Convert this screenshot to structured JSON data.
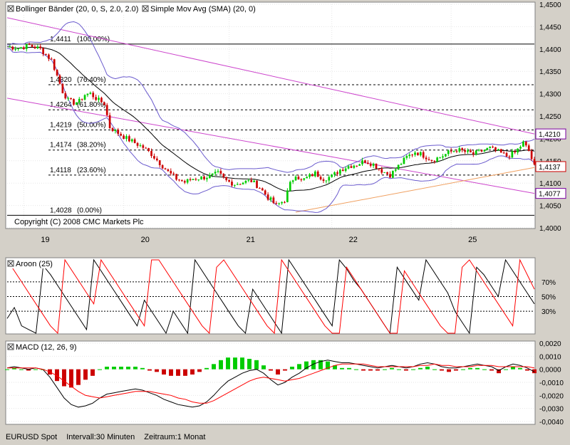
{
  "colors": {
    "panel_bg": "#ffffff",
    "frame_bg": "#d4d0c8",
    "up": "#00cc00",
    "down": "#cc0000",
    "bollinger": "#6a5acd",
    "sma": "#000000",
    "trend": "#cc44cc",
    "support": "#f0a060",
    "aroon_up": "#000000",
    "aroon_down": "#ff0000",
    "macd": "#000000",
    "signal": "#ff0000",
    "price_label_red": "#cc0000",
    "price_label_purple": "#7a00a0"
  },
  "legend": {
    "bollinger": "Bollinger Bänder (20, 0, S, 2.0, 2.0)",
    "sma": "Simple Mov Avg (SMA) (20, 0)",
    "aroon": "Aroon (25)",
    "macd": "MACD (12, 26, 9)"
  },
  "copyright": "Copyright (C) 2008 CMC Markets Plc",
  "footer": {
    "symbol": "EURUSD Spot",
    "interval": "Intervall:30 Minuten",
    "range": "Zeitraum:1 Monat"
  },
  "chart_data": [
    {
      "type": "candlestick",
      "panel": "price",
      "ylim": [
        1.4,
        1.45
      ],
      "y_ticks": [
        "1,4500",
        "1,4450",
        "1,4400",
        "1,4350",
        "1,4300",
        "1,4250",
        "1,4200",
        "1,4150",
        "1,4100",
        "1,4050",
        "1,4000"
      ],
      "x_ticks": [
        "19",
        "20",
        "21",
        "22",
        "25"
      ],
      "fibonacci": [
        {
          "price": 1.4411,
          "label": "1,4411",
          "pct": "(100.00%)"
        },
        {
          "price": 1.432,
          "label": "1,4320",
          "pct": "(76.40%)"
        },
        {
          "price": 1.4264,
          "label": "1,4264",
          "pct": "(61.80%)"
        },
        {
          "price": 1.4219,
          "label": "1,4219",
          "pct": "(50.00%)"
        },
        {
          "price": 1.4174,
          "label": "1,4174",
          "pct": "(38.20%)"
        },
        {
          "price": 1.4118,
          "label": "1,4118",
          "pct": "(23.60%)"
        },
        {
          "price": 1.4028,
          "label": "1,4028",
          "pct": "(0.00%)"
        }
      ],
      "price_labels": [
        {
          "value": "1,4210",
          "price": 1.421,
          "kind": "purple"
        },
        {
          "value": "1,4137",
          "price": 1.4137,
          "kind": "red"
        },
        {
          "value": "1,4077",
          "price": 1.4077,
          "kind": "purple"
        }
      ],
      "anchors": [
        [
          0,
          1.4405
        ],
        [
          4,
          1.4402
        ],
        [
          8,
          1.4408
        ],
        [
          12,
          1.44
        ],
        [
          16,
          1.4375
        ],
        [
          18,
          1.434
        ],
        [
          20,
          1.4305
        ],
        [
          22,
          1.4285
        ],
        [
          24,
          1.428
        ],
        [
          26,
          1.4283
        ],
        [
          28,
          1.4298
        ],
        [
          30,
          1.43
        ],
        [
          33,
          1.4285
        ],
        [
          35,
          1.4278
        ],
        [
          37,
          1.4225
        ],
        [
          40,
          1.4212
        ],
        [
          43,
          1.42
        ],
        [
          46,
          1.419
        ],
        [
          49,
          1.418
        ],
        [
          52,
          1.4165
        ],
        [
          55,
          1.4145
        ],
        [
          58,
          1.4125
        ],
        [
          61,
          1.411
        ],
        [
          64,
          1.4102
        ],
        [
          67,
          1.411
        ],
        [
          70,
          1.4112
        ],
        [
          73,
          1.4115
        ],
        [
          76,
          1.4122
        ],
        [
          79,
          1.4105
        ],
        [
          82,
          1.4098
        ],
        [
          85,
          1.4102
        ],
        [
          88,
          1.4105
        ],
        [
          91,
          1.409
        ],
        [
          94,
          1.4068
        ],
        [
          97,
          1.405
        ],
        [
          100,
          1.4062
        ],
        [
          102,
          1.4098
        ],
        [
          104,
          1.412
        ],
        [
          106,
          1.4105
        ],
        [
          108,
          1.4112
        ],
        [
          111,
          1.4122
        ],
        [
          114,
          1.411
        ],
        [
          117,
          1.4115
        ],
        [
          120,
          1.413
        ],
        [
          123,
          1.4138
        ],
        [
          126,
          1.4142
        ],
        [
          129,
          1.415
        ],
        [
          132,
          1.4142
        ],
        [
          135,
          1.4128
        ],
        [
          138,
          1.4118
        ],
        [
          141,
          1.4138
        ],
        [
          144,
          1.4158
        ],
        [
          147,
          1.417
        ],
        [
          150,
          1.4162
        ],
        [
          153,
          1.4152
        ],
        [
          156,
          1.4158
        ],
        [
          159,
          1.4168
        ],
        [
          162,
          1.4175
        ],
        [
          165,
          1.417
        ],
        [
          168,
          1.4165
        ],
        [
          171,
          1.4172
        ],
        [
          174,
          1.4178
        ],
        [
          177,
          1.417
        ],
        [
          180,
          1.416
        ],
        [
          183,
          1.4168
        ],
        [
          186,
          1.419
        ],
        [
          188,
          1.4172
        ],
        [
          190,
          1.4137
        ]
      ],
      "x_range": [
        0,
        190
      ],
      "day_positions": [
        6,
        42,
        80,
        117,
        160
      ],
      "trend_lines": [
        {
          "kind": "trend",
          "from": [
            0,
            1.447
          ],
          "to": [
            190,
            1.421
          ]
        },
        {
          "kind": "trend",
          "from": [
            0,
            1.429
          ],
          "to": [
            190,
            1.4077
          ]
        },
        {
          "kind": "support",
          "from": [
            104,
            1.4035
          ],
          "to": [
            190,
            1.4135
          ]
        }
      ]
    },
    {
      "type": "line",
      "panel": "aroon",
      "ylim": [
        0,
        100
      ],
      "y_ticks": [
        "70%",
        "50%",
        "30%"
      ],
      "levels": [
        70,
        50,
        30
      ],
      "x_range": [
        0,
        190
      ],
      "series": [
        {
          "name": "aroon-up",
          "values": [
            20,
            35,
            10,
            5,
            0,
            92,
            80,
            65,
            50,
            35,
            20,
            5,
            100,
            85,
            70,
            55,
            40,
            25,
            10,
            45,
            30,
            15,
            0,
            30,
            15,
            0,
            100,
            85,
            70,
            55,
            40,
            25,
            10,
            0,
            60,
            45,
            30,
            15,
            0,
            100,
            85,
            70,
            55,
            40,
            25,
            10,
            100,
            88,
            72,
            60,
            45,
            30,
            15,
            0,
            90,
            75,
            60,
            45,
            100,
            85,
            70,
            55,
            30,
            15,
            0,
            90,
            80,
            65,
            50,
            100,
            85,
            70,
            55,
            40
          ]
        },
        {
          "name": "aroon-down",
          "values": [
            100,
            85,
            70,
            55,
            40,
            25,
            10,
            0,
            100,
            85,
            70,
            55,
            40,
            100,
            85,
            70,
            55,
            40,
            25,
            10,
            100,
            100,
            85,
            70,
            55,
            40,
            25,
            10,
            0,
            90,
            100,
            85,
            70,
            55,
            40,
            25,
            10,
            0,
            100,
            85,
            70,
            55,
            40,
            25,
            10,
            0,
            0,
            90,
            75,
            60,
            45,
            30,
            15,
            0,
            0,
            85,
            70,
            55,
            40,
            25,
            10,
            0,
            0,
            90,
            100,
            85,
            70,
            55,
            40,
            25,
            10,
            100,
            80,
            60
          ]
        }
      ]
    },
    {
      "type": "bar+line",
      "panel": "macd",
      "ylim": [
        -0.004,
        0.002
      ],
      "y_ticks": [
        "0,0020",
        "0,0010",
        "0,0000",
        "-0,0010",
        "-0,0020",
        "-0,0030",
        "-0,0040"
      ],
      "x_range": [
        0,
        190
      ],
      "macd": [
        0.0001,
        0.0002,
        0.0001,
        0.0,
        0.0001,
        0.0,
        -0.0006,
        -0.0014,
        -0.0022,
        -0.0027,
        -0.0029,
        -0.0028,
        -0.0026,
        -0.0022,
        -0.0019,
        -0.0018,
        -0.0017,
        -0.0016,
        -0.0015,
        -0.0016,
        -0.0018,
        -0.002,
        -0.0023,
        -0.0025,
        -0.0027,
        -0.0028,
        -0.0029,
        -0.0028,
        -0.0025,
        -0.002,
        -0.0014,
        -0.0009,
        -0.0006,
        -0.0003,
        -0.0001,
        0.0,
        -0.0003,
        -0.0008,
        -0.0012,
        -0.001,
        -0.0006,
        -0.0003,
        0.0001,
        0.0004,
        0.0006,
        0.0007,
        0.0006,
        0.0005,
        0.0005,
        0.0004,
        0.0003,
        0.0002,
        0.0001,
        0.0002,
        0.0003,
        0.0002,
        0.0001,
        0.0002,
        0.0004,
        0.0005,
        0.0004,
        0.0002,
        0.0001,
        0.0001,
        0.0002,
        0.0003,
        0.0004,
        0.0003,
        0.0002,
        -0.0001,
        0.0002,
        0.0004,
        0.0003,
        0.0001,
        -0.0002
      ],
      "signal": [
        0.0001,
        0.0001,
        0.0001,
        0.0001,
        0.0001,
        0.0,
        -0.0002,
        -0.0005,
        -0.0009,
        -0.0013,
        -0.0017,
        -0.002,
        -0.0021,
        -0.0022,
        -0.0021,
        -0.002,
        -0.0019,
        -0.0018,
        -0.0017,
        -0.0017,
        -0.0017,
        -0.0018,
        -0.0019,
        -0.002,
        -0.0022,
        -0.0023,
        -0.0025,
        -0.0026,
        -0.0026,
        -0.0024,
        -0.0021,
        -0.0018,
        -0.0015,
        -0.0012,
        -0.0009,
        -0.0007,
        -0.0006,
        -0.0007,
        -0.0008,
        -0.0009,
        -0.0008,
        -0.0007,
        -0.0005,
        -0.0003,
        -0.0001,
        0.0001,
        0.0003,
        0.0004,
        0.0004,
        0.0004,
        0.0004,
        0.0003,
        0.0002,
        0.0002,
        0.0002,
        0.0002,
        0.0002,
        0.0002,
        0.0003,
        0.0003,
        0.0004,
        0.0003,
        0.0003,
        0.0002,
        0.0002,
        0.0002,
        0.0003,
        0.0003,
        0.0003,
        0.0002,
        0.0002,
        0.0002,
        0.0002,
        0.0002,
        0.0001
      ]
    }
  ]
}
